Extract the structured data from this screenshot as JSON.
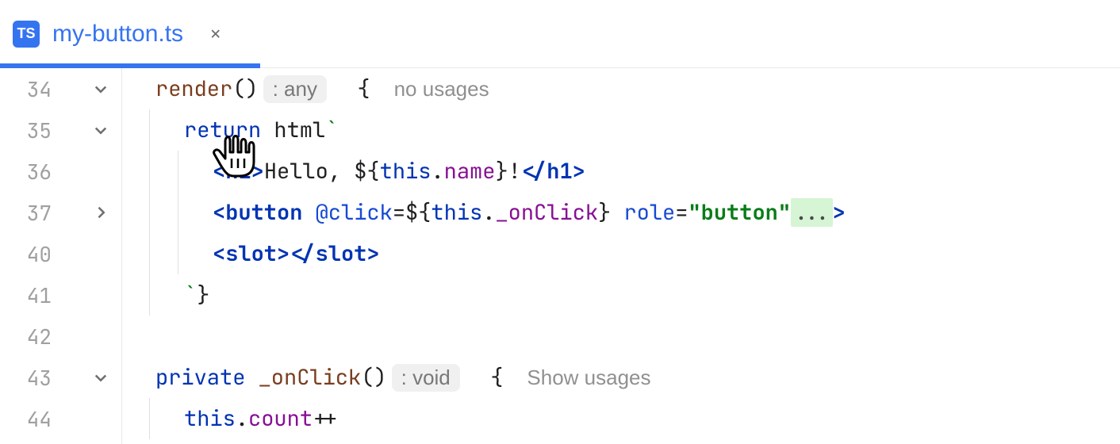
{
  "tab": {
    "icon_text": "TS",
    "filename": "my-button.ts"
  },
  "lines": [
    {
      "num": "34"
    },
    {
      "num": "35"
    },
    {
      "num": "36"
    },
    {
      "num": "37"
    },
    {
      "num": "40"
    },
    {
      "num": "41"
    },
    {
      "num": "42"
    },
    {
      "num": "43"
    },
    {
      "num": "44"
    }
  ],
  "hints": {
    "render_return": ": any",
    "onclick_return": ": void",
    "no_usages": "no usages",
    "show_usages": "Show usages",
    "fold_ellipsis": "..."
  },
  "code": {
    "l34_render": "render",
    "l34_parens": "()",
    "l34_brace": "{",
    "l35_return": "return",
    "l35_html": " html",
    "l35_tick": "`",
    "l36_open_h1": "<h1>",
    "l36_hello": "Hello, ",
    "l36_dollar": "${",
    "l36_this": "this",
    "l36_dot": ".",
    "l36_name": "name",
    "l36_close_interp": "}",
    "l36_bang": "!",
    "l36_close_h1": "</h1>",
    "l37_open_button": "<button",
    "l37_click_attr": " @click",
    "l37_eq": "=",
    "l37_dollar": "${",
    "l37_this": "this",
    "l37_dot": ".",
    "l37_onclick": "_onClick",
    "l37_close_interp": "}",
    "l37_role_attr": " role",
    "l37_eq2": "=",
    "l37_role_val": "\"button\"",
    "l37_gt": ">",
    "l40_slot": "<slot></slot>",
    "l41_tick": "`",
    "l41_brace": "}",
    "l43_private": "private",
    "l43_space": " ",
    "l43_onclick": "_onClick",
    "l43_parens": "()",
    "l43_brace": "{",
    "l44_this": "this",
    "l44_dot": ".",
    "l44_count": "count",
    "l44_pp": "++"
  }
}
